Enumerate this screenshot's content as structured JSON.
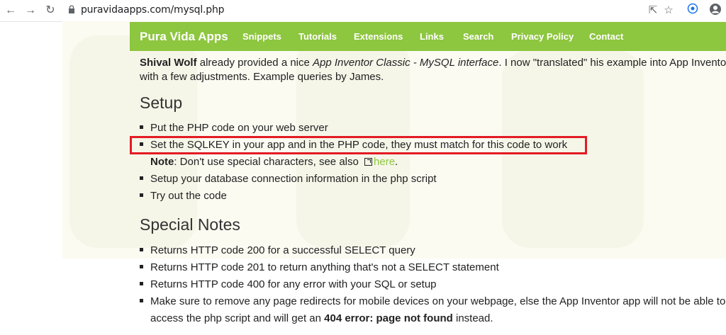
{
  "browser": {
    "url": "puravidaapps.com/mysql.php",
    "back_icon": "arrow-left-icon",
    "forward_icon": "arrow-right-icon",
    "reload_icon": "reload-icon"
  },
  "site": {
    "brand": "Pura Vida Apps",
    "brand_color": "#8dc63f",
    "nav": [
      "Snippets",
      "Tutorials",
      "Extensions",
      "Links",
      "Search",
      "Privacy Policy",
      "Contact"
    ]
  },
  "intro": {
    "author": "Shival Wolf",
    "text1": " already provided a nice ",
    "italic": "App Inventor Classic - MySQL interface",
    "text2": ". I now \"translated\" his example into App Invento",
    "line2": "with a few adjustments. Example queries by James."
  },
  "setup": {
    "title": "Setup",
    "items": [
      "Put the PHP code on your web server",
      "Set the SQLKEY in your app and in the PHP code, they must match for this code to work",
      "Setup your database connection information in the php script",
      "Try out the code"
    ],
    "note_label": "Note",
    "note_text": ": Don't use special characters, see also ",
    "note_link": "here",
    "note_end": "."
  },
  "special": {
    "title": "Special Notes",
    "items": [
      "Returns HTTP code 200 for a successful SELECT query",
      "Returns HTTP code 201 to return anything that's not a SELECT statement",
      "Returns HTTP code 400 for any error with your SQL or setup",
      "Make sure to remove any page redirects for mobile devices on your webpage, else the App Inventor app will not be able to"
    ],
    "last_line_start": "access the php script and will get an ",
    "bold1": "404 error: page not found",
    "last_line_end": " instead."
  },
  "highlight_color": "#e31b23"
}
